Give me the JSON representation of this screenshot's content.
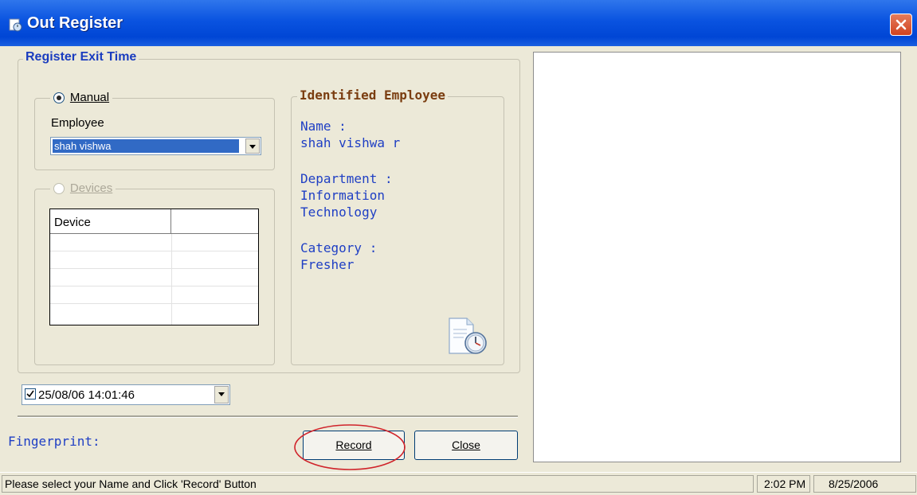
{
  "window": {
    "title": "Out Register",
    "close_icon": "close-icon"
  },
  "register": {
    "legend": "Register Exit Time",
    "manual": {
      "label": "Manual",
      "selected": true
    },
    "employee_label": "Employee",
    "employee_value": "shah vishwa",
    "devices": {
      "label": "Devices",
      "selected": false,
      "enabled": false
    },
    "device_table": {
      "columns": [
        "Device",
        ""
      ],
      "rows": [
        [
          "",
          ""
        ],
        [
          "",
          ""
        ],
        [
          "",
          ""
        ],
        [
          "",
          ""
        ],
        [
          "",
          ""
        ]
      ]
    },
    "datetime": {
      "checked": true,
      "value": "25/08/06 14:01:46"
    }
  },
  "identified": {
    "legend": "Identified Employee",
    "name_label": "Name :",
    "name_value": "shah vishwa r",
    "department_label": "Department :",
    "department_value_line1": "Information",
    "department_value_line2": "Technology",
    "category_label": "Category :",
    "category_value": "Fresher"
  },
  "fingerprint_label": "Fingerprint:",
  "buttons": {
    "record": "Record",
    "close": "Close"
  },
  "status": {
    "message": "Please select your Name and Click 'Record' Button",
    "time": "2:02 PM",
    "date": "8/25/2006"
  }
}
